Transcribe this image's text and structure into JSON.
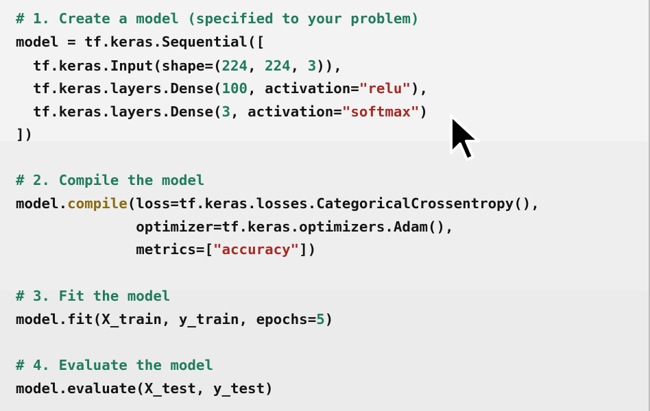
{
  "code": {
    "lines": [
      {
        "segments": [
          {
            "text": "# 1. Create a model (specified to your problem)",
            "kind": "c"
          }
        ]
      },
      {
        "segments": [
          {
            "text": "model = tf.keras.Sequential([",
            "kind": ""
          }
        ]
      },
      {
        "segments": [
          {
            "text": "  tf.keras.Input(shape=(",
            "kind": ""
          },
          {
            "text": "224",
            "kind": "n"
          },
          {
            "text": ", ",
            "kind": ""
          },
          {
            "text": "224",
            "kind": "n"
          },
          {
            "text": ", ",
            "kind": ""
          },
          {
            "text": "3",
            "kind": "n"
          },
          {
            "text": ")),",
            "kind": ""
          }
        ]
      },
      {
        "segments": [
          {
            "text": "  tf.keras.layers.Dense(",
            "kind": ""
          },
          {
            "text": "100",
            "kind": "n"
          },
          {
            "text": ", activation=",
            "kind": ""
          },
          {
            "text": "\"relu\"",
            "kind": "s"
          },
          {
            "text": "),",
            "kind": ""
          }
        ]
      },
      {
        "segments": [
          {
            "text": "  tf.keras.layers.Dense(",
            "kind": ""
          },
          {
            "text": "3",
            "kind": "n"
          },
          {
            "text": ", activation=",
            "kind": ""
          },
          {
            "text": "\"softmax\"",
            "kind": "s"
          },
          {
            "text": ")",
            "kind": ""
          }
        ]
      },
      {
        "segments": [
          {
            "text": "])",
            "kind": ""
          }
        ]
      },
      {
        "segments": [
          {
            "text": "# 2. Compile the model",
            "kind": "c"
          }
        ]
      },
      {
        "segments": [
          {
            "text": "model.",
            "kind": ""
          },
          {
            "text": "compile",
            "kind": "f"
          },
          {
            "text": "(loss=tf.keras.losses.CategoricalCrossentropy(),",
            "kind": ""
          }
        ]
      },
      {
        "segments": [
          {
            "text": "              optimizer=tf.keras.optimizers.Adam(),",
            "kind": ""
          }
        ]
      },
      {
        "segments": [
          {
            "text": "              metrics=[",
            "kind": ""
          },
          {
            "text": "\"accuracy\"",
            "kind": "s"
          },
          {
            "text": "])",
            "kind": ""
          }
        ]
      },
      {
        "segments": [
          {
            "text": "# 3. Fit the model",
            "kind": "c"
          }
        ]
      },
      {
        "segments": [
          {
            "text": "model.fit(X_train, y_train, epochs=",
            "kind": ""
          },
          {
            "text": "5",
            "kind": "n"
          },
          {
            "text": ")",
            "kind": ""
          }
        ]
      },
      {
        "segments": [
          {
            "text": "# 4. Evaluate the model",
            "kind": "c"
          }
        ]
      },
      {
        "segments": [
          {
            "text": "model.evaluate(X_test, y_test)",
            "kind": ""
          }
        ]
      }
    ]
  },
  "colors": {
    "background": "#f2f2f2",
    "text": "#141414",
    "comment": "#1f7d5c",
    "number": "#1f7d5c",
    "string": "#a52a25",
    "builtin": "#8a6a12"
  },
  "cursor": {
    "icon": "arrow-cursor-icon"
  }
}
